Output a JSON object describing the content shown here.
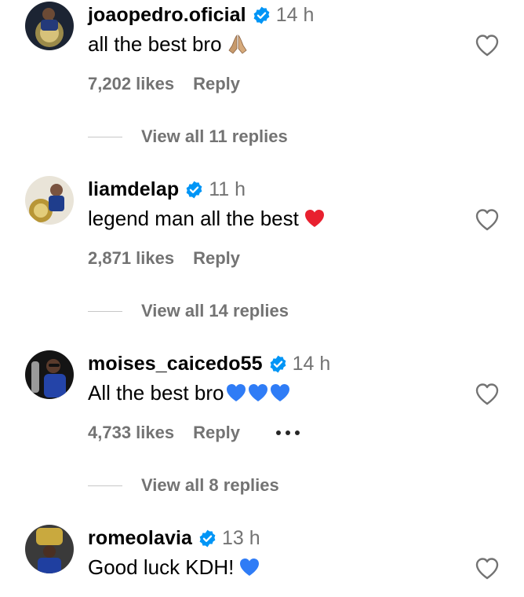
{
  "comments": [
    {
      "username": "joaopedro.oficial",
      "time": "14 h",
      "text": "all the best bro",
      "emoji": "folded-hands-icon",
      "likes": "7,202 likes",
      "reply": "Reply",
      "view_replies": "View all 11 replies"
    },
    {
      "username": "liamdelap",
      "time": "11 h",
      "text": "legend man all the best",
      "emoji": "red-heart-icon",
      "likes": "2,871 likes",
      "reply": "Reply",
      "view_replies": "View all 14 replies"
    },
    {
      "username": "moises_caicedo55",
      "time": "14 h",
      "text": "All the best bro",
      "emoji": "blue-hearts-icon",
      "likes": "4,733 likes",
      "reply": "Reply",
      "view_replies": "View all 8 replies"
    },
    {
      "username": "romeolavia",
      "time": "13 h",
      "text": "Good luck KDH!",
      "emoji": "blue-heart-icon"
    }
  ],
  "colors": {
    "verified": "#0095F6",
    "meta_text": "#737373",
    "red_heart": "#E8202F",
    "blue_heart": "#2F7CF6"
  }
}
